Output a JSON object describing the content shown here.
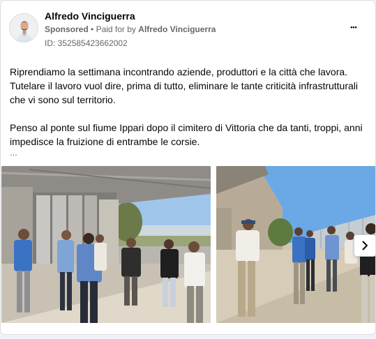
{
  "post": {
    "author": "Alfredo Vinciguerra",
    "sponsored": "Sponsored",
    "separator": "•",
    "paid_for_by": "Paid for by",
    "payer": "Alfredo Vinciguerra",
    "ad_id": "ID: 352585423662002",
    "more_label": "•••",
    "paragraphs": [
      "Riprendiamo la settimana incontrando aziende, produttori e la città che lavora. Tutelare il lavoro vuol dire, prima di tutto, eliminare le tante criticità infrastrutturali che vi sono sul territorio.",
      "Penso al ponte sul fiume Ippari dopo il cimitero di Vittoria che da tanti, troppi, anni impedisce la fruizione di entrambe le corsie."
    ],
    "ellipsis": "..."
  },
  "carousel": {
    "next_icon": "chevron-right-icon"
  },
  "colors": {
    "text_primary": "#050505",
    "text_secondary": "#65676b",
    "card_bg": "#ffffff",
    "page_bg": "#f0f2f5",
    "sky": "#6aa9e6",
    "shirt_blue": "#3b73c4"
  }
}
